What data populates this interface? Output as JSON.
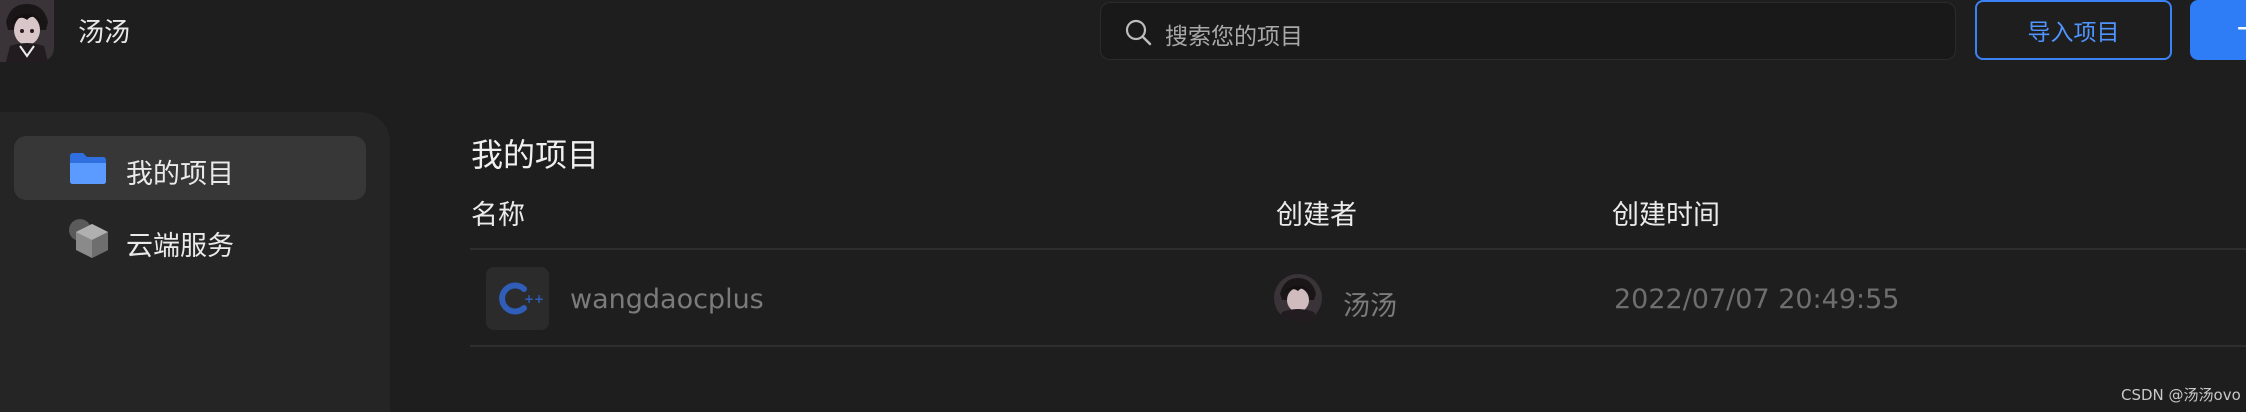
{
  "header": {
    "user_name": "汤汤",
    "search_placeholder": "搜索您的项目",
    "import_label": "导入项目",
    "new_label": "+"
  },
  "sidebar": {
    "items": [
      {
        "label": "我的项目",
        "icon": "folder-icon",
        "active": true
      },
      {
        "label": "云端服务",
        "icon": "cube-icon",
        "active": false
      }
    ]
  },
  "main": {
    "title": "我的项目",
    "columns": [
      "名称",
      "创建者",
      "创建时间"
    ],
    "rows": [
      {
        "name": "wangdaocplus",
        "icon": "cpp-icon",
        "creator": "汤汤",
        "created_at": "2022/07/07 20:49:55"
      }
    ]
  },
  "watermark": "CSDN @汤汤ovo",
  "colors": {
    "background": "#1e1e1e",
    "sidebar": "#252525",
    "accent": "#2e7cf6"
  }
}
